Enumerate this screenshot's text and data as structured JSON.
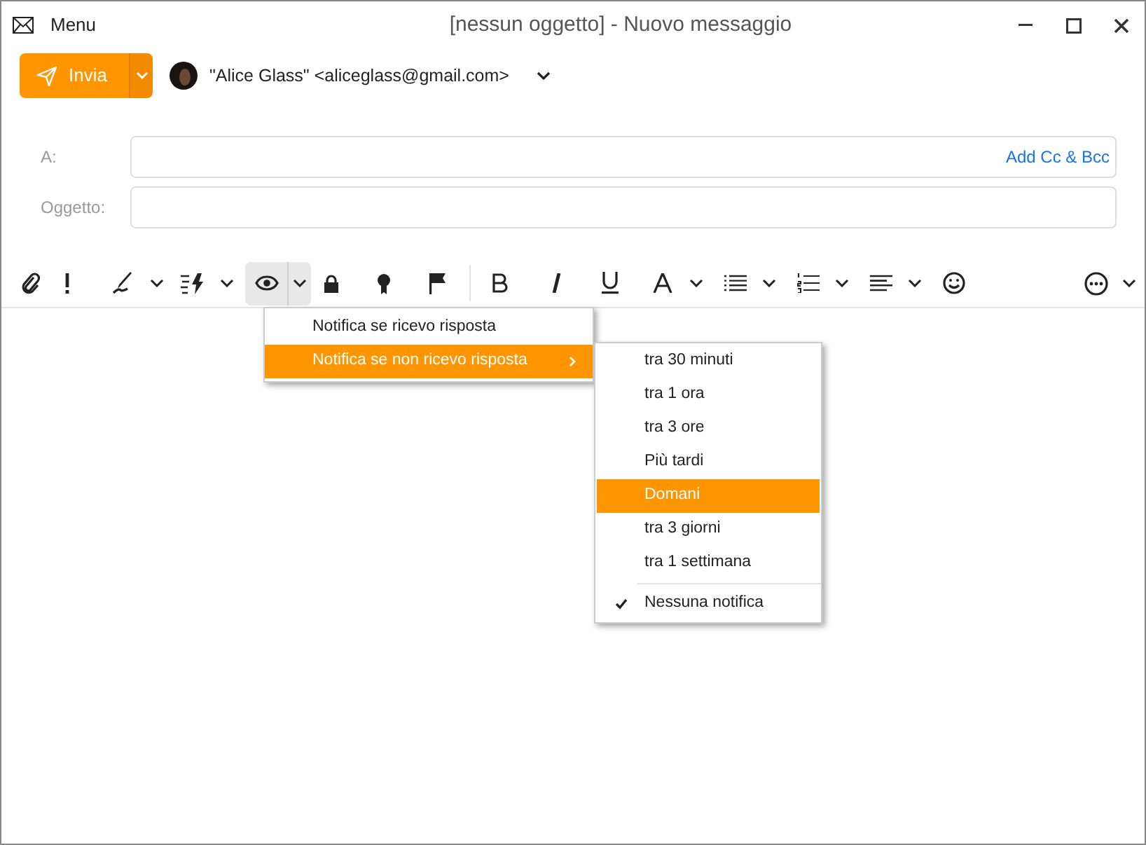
{
  "window": {
    "menu_label": "Menu",
    "title": "[nessun oggetto] - Nuovo messaggio"
  },
  "send_button": {
    "label": "Invia"
  },
  "from": {
    "identity": "\"Alice Glass\" <aliceglass@gmail.com>"
  },
  "fields": [
    {
      "label": "A:",
      "link": "Add Cc & Bcc"
    },
    {
      "label": "Oggetto:"
    }
  ],
  "toolbar": [
    {
      "has_menu": false,
      "selected": false
    },
    {
      "has_menu": false,
      "selected": false
    },
    {
      "has_menu": true,
      "selected": false
    },
    {
      "has_menu": true,
      "selected": false
    },
    {
      "has_menu": true,
      "selected": true
    },
    {
      "has_menu": false,
      "selected": false
    },
    {
      "has_menu": false,
      "selected": false
    },
    {
      "has_menu": false,
      "selected": false
    },
    {
      "has_menu": false,
      "selected": false
    },
    {
      "has_menu": false,
      "selected": false
    },
    {
      "has_menu": false,
      "selected": false
    },
    {
      "has_menu": true,
      "selected": false
    },
    {
      "has_menu": true,
      "selected": false
    },
    {
      "has_menu": true,
      "selected": false
    },
    {
      "has_menu": true,
      "selected": false
    },
    {
      "has_menu": false,
      "selected": false
    },
    {
      "has_menu": true,
      "selected": false
    }
  ],
  "menu": [
    {
      "label": "Notifica se ricevo risposta",
      "selected": false,
      "submenu": false
    },
    {
      "label": "Notifica se non ricevo risposta",
      "selected": true,
      "submenu": true
    }
  ],
  "submenu": [
    {
      "label": "tra 30 minuti",
      "selected": false,
      "checked": false
    },
    {
      "label": "tra 1 ora",
      "selected": false,
      "checked": false
    },
    {
      "label": "tra 3 ore",
      "selected": false,
      "checked": false
    },
    {
      "label": "Più tardi",
      "selected": false,
      "checked": false
    },
    {
      "label": "Domani",
      "selected": true,
      "checked": false
    },
    {
      "label": "tra 3 giorni",
      "selected": false,
      "checked": false
    },
    {
      "label": "tra 1 settimana",
      "selected": false,
      "checked": false
    },
    {
      "label": "Nessuna notifica",
      "selected": false,
      "checked": true,
      "separator_before": true
    }
  ]
}
